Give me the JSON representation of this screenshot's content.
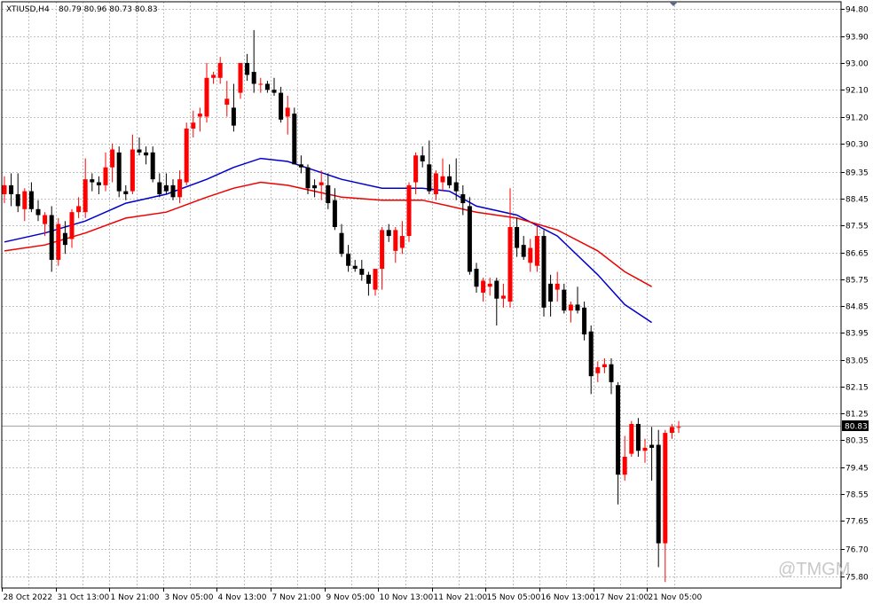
{
  "header": {
    "symbol": "XTIUSD,H4",
    "ohlc": "80.79 80.96 80.73 80.83"
  },
  "watermark": "@TMGM",
  "current_price_label": "80.83",
  "colors": {
    "bull": "#ff0000",
    "bear": "#000000",
    "ma_fast": "#0000cc",
    "ma_slow": "#ee0000",
    "grid": "#c0c0c0",
    "frame": "#000000"
  },
  "chart_data": {
    "type": "candlestick",
    "ylim": [
      75.4,
      95.05
    ],
    "y_ticks": [
      "94.80",
      "93.90",
      "93.00",
      "92.10",
      "91.20",
      "90.30",
      "89.35",
      "88.45",
      "87.55",
      "86.65",
      "85.75",
      "84.85",
      "83.95",
      "83.05",
      "82.15",
      "81.25",
      "80.35",
      "79.45",
      "78.55",
      "77.65",
      "76.70",
      "75.80"
    ],
    "x_tick_labels": [
      "28 Oct 2022",
      "31 Oct 13:00",
      "1 Nov 21:00",
      "3 Nov 05:00",
      "4 Nov 13:00",
      "7 Nov 21:00",
      "9 Nov 05:00",
      "10 Nov 13:00",
      "11 Nov 21:00",
      "15 Nov 05:00",
      "16 Nov 13:00",
      "17 Nov 21:00",
      "21 Nov 05:00"
    ],
    "candles": [
      {
        "o": 88.6,
        "h": 89.2,
        "l": 88.3,
        "c": 88.9
      },
      {
        "o": 88.9,
        "h": 89.3,
        "l": 88.2,
        "c": 88.6
      },
      {
        "o": 88.6,
        "h": 89.3,
        "l": 88.0,
        "c": 88.2
      },
      {
        "o": 88.1,
        "h": 88.8,
        "l": 87.7,
        "c": 88.7
      },
      {
        "o": 88.7,
        "h": 89.0,
        "l": 88.0,
        "c": 88.1
      },
      {
        "o": 88.1,
        "h": 88.4,
        "l": 87.7,
        "c": 87.9
      },
      {
        "o": 87.6,
        "h": 88.0,
        "l": 87.2,
        "c": 87.9
      },
      {
        "o": 87.9,
        "h": 88.2,
        "l": 86.0,
        "c": 86.4
      },
      {
        "o": 86.4,
        "h": 87.8,
        "l": 86.2,
        "c": 87.6
      },
      {
        "o": 87.3,
        "h": 87.7,
        "l": 86.6,
        "c": 86.9
      },
      {
        "o": 87.1,
        "h": 88.1,
        "l": 86.8,
        "c": 88.0
      },
      {
        "o": 88.0,
        "h": 88.5,
        "l": 87.8,
        "c": 88.2
      },
      {
        "o": 88.0,
        "h": 89.8,
        "l": 87.8,
        "c": 89.1
      },
      {
        "o": 89.1,
        "h": 89.3,
        "l": 88.7,
        "c": 89.0
      },
      {
        "o": 89.0,
        "h": 89.2,
        "l": 88.6,
        "c": 88.9
      },
      {
        "o": 88.9,
        "h": 90.0,
        "l": 88.7,
        "c": 89.5
      },
      {
        "o": 89.5,
        "h": 90.3,
        "l": 89.0,
        "c": 90.1
      },
      {
        "o": 90.0,
        "h": 90.2,
        "l": 88.5,
        "c": 88.7
      },
      {
        "o": 88.7,
        "h": 88.9,
        "l": 88.4,
        "c": 88.6
      },
      {
        "o": 88.7,
        "h": 90.6,
        "l": 88.6,
        "c": 90.1
      },
      {
        "o": 90.1,
        "h": 90.5,
        "l": 89.9,
        "c": 90.0
      },
      {
        "o": 90.0,
        "h": 90.2,
        "l": 89.6,
        "c": 89.9
      },
      {
        "o": 90.0,
        "h": 90.2,
        "l": 89.0,
        "c": 89.1
      },
      {
        "o": 89.0,
        "h": 89.3,
        "l": 88.5,
        "c": 88.6
      },
      {
        "o": 88.9,
        "h": 89.3,
        "l": 88.6,
        "c": 88.7
      },
      {
        "o": 88.9,
        "h": 89.1,
        "l": 88.4,
        "c": 88.5
      },
      {
        "o": 88.5,
        "h": 89.4,
        "l": 88.3,
        "c": 89.1
      },
      {
        "o": 89.0,
        "h": 91.0,
        "l": 88.9,
        "c": 90.8
      },
      {
        "o": 90.8,
        "h": 91.4,
        "l": 90.5,
        "c": 91.0
      },
      {
        "o": 91.2,
        "h": 91.5,
        "l": 90.7,
        "c": 91.3
      },
      {
        "o": 91.2,
        "h": 93.0,
        "l": 91.0,
        "c": 92.5
      },
      {
        "o": 92.5,
        "h": 92.7,
        "l": 92.3,
        "c": 92.6
      },
      {
        "o": 92.5,
        "h": 93.2,
        "l": 92.3,
        "c": 93.0
      },
      {
        "o": 91.6,
        "h": 92.4,
        "l": 91.2,
        "c": 91.8
      },
      {
        "o": 91.5,
        "h": 92.3,
        "l": 90.7,
        "c": 90.9
      },
      {
        "o": 92.0,
        "h": 93.0,
        "l": 91.8,
        "c": 93.0
      },
      {
        "o": 93.0,
        "h": 93.3,
        "l": 92.4,
        "c": 92.6
      },
      {
        "o": 92.7,
        "h": 94.1,
        "l": 92.0,
        "c": 92.3
      },
      {
        "o": 92.3,
        "h": 92.5,
        "l": 92.0,
        "c": 92.3
      },
      {
        "o": 92.3,
        "h": 92.4,
        "l": 92.0,
        "c": 92.1
      },
      {
        "o": 92.1,
        "h": 92.5,
        "l": 91.9,
        "c": 92.0
      },
      {
        "o": 92.0,
        "h": 92.2,
        "l": 91.0,
        "c": 91.1
      },
      {
        "o": 91.2,
        "h": 91.9,
        "l": 90.6,
        "c": 91.5
      },
      {
        "o": 91.3,
        "h": 91.5,
        "l": 89.6,
        "c": 89.6
      },
      {
        "o": 89.6,
        "h": 89.9,
        "l": 89.3,
        "c": 89.5
      },
      {
        "o": 89.5,
        "h": 89.6,
        "l": 88.6,
        "c": 88.8
      },
      {
        "o": 88.9,
        "h": 89.1,
        "l": 88.5,
        "c": 88.8
      },
      {
        "o": 88.9,
        "h": 89.4,
        "l": 88.4,
        "c": 89.0
      },
      {
        "o": 88.9,
        "h": 89.3,
        "l": 88.1,
        "c": 88.3
      },
      {
        "o": 88.4,
        "h": 88.8,
        "l": 87.4,
        "c": 87.5
      },
      {
        "o": 87.3,
        "h": 87.6,
        "l": 86.5,
        "c": 86.6
      },
      {
        "o": 86.6,
        "h": 86.9,
        "l": 86.0,
        "c": 86.2
      },
      {
        "o": 86.2,
        "h": 86.4,
        "l": 86.0,
        "c": 86.1
      },
      {
        "o": 86.1,
        "h": 86.4,
        "l": 85.7,
        "c": 85.9
      },
      {
        "o": 85.9,
        "h": 86.0,
        "l": 85.2,
        "c": 85.6
      },
      {
        "o": 85.4,
        "h": 86.0,
        "l": 85.2,
        "c": 86.1
      },
      {
        "o": 86.1,
        "h": 87.5,
        "l": 85.4,
        "c": 87.4
      },
      {
        "o": 87.4,
        "h": 87.6,
        "l": 87.0,
        "c": 87.2
      },
      {
        "o": 86.7,
        "h": 87.5,
        "l": 86.3,
        "c": 87.4
      },
      {
        "o": 86.8,
        "h": 87.7,
        "l": 86.6,
        "c": 87.2
      },
      {
        "o": 87.2,
        "h": 89.0,
        "l": 87.0,
        "c": 88.9
      },
      {
        "o": 89.0,
        "h": 90.0,
        "l": 88.6,
        "c": 89.9
      },
      {
        "o": 89.9,
        "h": 90.2,
        "l": 89.5,
        "c": 89.7
      },
      {
        "o": 89.6,
        "h": 90.4,
        "l": 88.6,
        "c": 88.7
      },
      {
        "o": 88.6,
        "h": 89.4,
        "l": 88.4,
        "c": 89.3
      },
      {
        "o": 89.0,
        "h": 89.8,
        "l": 88.7,
        "c": 89.2
      },
      {
        "o": 89.2,
        "h": 89.6,
        "l": 88.8,
        "c": 88.9
      },
      {
        "o": 89.0,
        "h": 89.8,
        "l": 88.4,
        "c": 88.7
      },
      {
        "o": 88.6,
        "h": 88.9,
        "l": 87.9,
        "c": 88.3
      },
      {
        "o": 88.2,
        "h": 88.5,
        "l": 85.9,
        "c": 86.0
      },
      {
        "o": 86.1,
        "h": 86.3,
        "l": 85.3,
        "c": 85.5
      },
      {
        "o": 85.3,
        "h": 85.8,
        "l": 85.0,
        "c": 85.7
      },
      {
        "o": 85.5,
        "h": 85.8,
        "l": 85.2,
        "c": 85.6
      },
      {
        "o": 85.7,
        "h": 85.8,
        "l": 84.2,
        "c": 85.1
      },
      {
        "o": 85.1,
        "h": 85.6,
        "l": 84.8,
        "c": 85.2
      },
      {
        "o": 85.0,
        "h": 88.8,
        "l": 84.8,
        "c": 87.5
      },
      {
        "o": 87.5,
        "h": 87.8,
        "l": 86.5,
        "c": 86.8
      },
      {
        "o": 86.9,
        "h": 87.2,
        "l": 86.4,
        "c": 86.5
      },
      {
        "o": 86.3,
        "h": 87.1,
        "l": 86.0,
        "c": 86.8
      },
      {
        "o": 86.2,
        "h": 87.6,
        "l": 86.0,
        "c": 87.2
      },
      {
        "o": 87.2,
        "h": 87.4,
        "l": 84.5,
        "c": 84.8
      },
      {
        "o": 85.6,
        "h": 85.9,
        "l": 84.5,
        "c": 85.0
      },
      {
        "o": 85.4,
        "h": 86.0,
        "l": 85.0,
        "c": 85.6
      },
      {
        "o": 85.4,
        "h": 85.6,
        "l": 84.6,
        "c": 84.7
      },
      {
        "o": 84.7,
        "h": 85.0,
        "l": 84.3,
        "c": 84.9
      },
      {
        "o": 84.9,
        "h": 85.5,
        "l": 84.6,
        "c": 84.7
      },
      {
        "o": 84.8,
        "h": 85.0,
        "l": 83.7,
        "c": 83.9
      },
      {
        "o": 84.0,
        "h": 84.2,
        "l": 81.9,
        "c": 82.5
      },
      {
        "o": 82.6,
        "h": 83.0,
        "l": 82.3,
        "c": 82.8
      },
      {
        "o": 82.8,
        "h": 83.1,
        "l": 82.6,
        "c": 82.9
      },
      {
        "o": 82.9,
        "h": 83.1,
        "l": 81.9,
        "c": 82.3
      },
      {
        "o": 82.2,
        "h": 82.3,
        "l": 78.2,
        "c": 79.2
      },
      {
        "o": 79.2,
        "h": 80.5,
        "l": 79.0,
        "c": 79.8
      },
      {
        "o": 79.9,
        "h": 81.0,
        "l": 79.8,
        "c": 80.9
      },
      {
        "o": 80.9,
        "h": 81.1,
        "l": 79.8,
        "c": 80.0
      },
      {
        "o": 80.0,
        "h": 80.4,
        "l": 79.6,
        "c": 80.1
      },
      {
        "o": 80.2,
        "h": 80.8,
        "l": 79.0,
        "c": 80.1
      },
      {
        "o": 80.2,
        "h": 80.7,
        "l": 76.1,
        "c": 76.9
      },
      {
        "o": 76.9,
        "h": 80.7,
        "l": 75.6,
        "c": 80.6
      },
      {
        "o": 80.6,
        "h": 80.9,
        "l": 80.4,
        "c": 80.8
      },
      {
        "o": 80.8,
        "h": 81.0,
        "l": 80.6,
        "c": 80.8
      }
    ],
    "series": [
      {
        "color": "blue",
        "values": [
          [
            0,
            87.0
          ],
          [
            6,
            87.3
          ],
          [
            12,
            87.7
          ],
          [
            18,
            88.3
          ],
          [
            24,
            88.6
          ],
          [
            30,
            89.1
          ],
          [
            34,
            89.5
          ],
          [
            38,
            89.8
          ],
          [
            42,
            89.7
          ],
          [
            46,
            89.4
          ],
          [
            50,
            89.1
          ],
          [
            56,
            88.8
          ],
          [
            62,
            88.8
          ],
          [
            66,
            88.7
          ],
          [
            70,
            88.2
          ],
          [
            76,
            87.9
          ],
          [
            82,
            87.2
          ],
          [
            88,
            85.9
          ],
          [
            92,
            84.9
          ],
          [
            96,
            84.3
          ]
        ]
      },
      {
        "color": "red",
        "values": [
          [
            0,
            86.7
          ],
          [
            6,
            86.9
          ],
          [
            12,
            87.3
          ],
          [
            18,
            87.8
          ],
          [
            24,
            88.0
          ],
          [
            30,
            88.5
          ],
          [
            34,
            88.8
          ],
          [
            38,
            89.0
          ],
          [
            42,
            88.9
          ],
          [
            46,
            88.7
          ],
          [
            50,
            88.5
          ],
          [
            56,
            88.4
          ],
          [
            62,
            88.4
          ],
          [
            66,
            88.2
          ],
          [
            70,
            88.0
          ],
          [
            76,
            87.8
          ],
          [
            82,
            87.4
          ],
          [
            88,
            86.7
          ],
          [
            92,
            86.0
          ],
          [
            96,
            85.5
          ]
        ]
      }
    ]
  }
}
